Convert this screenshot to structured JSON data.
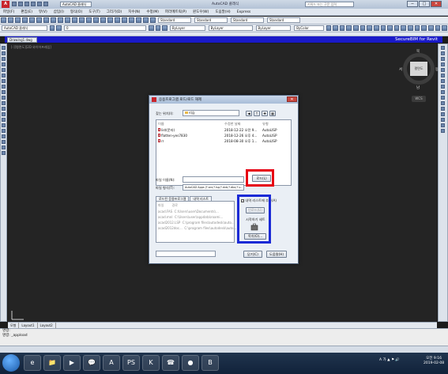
{
  "app": {
    "title": "AutoCAD 클래식",
    "workspace": "AutoCAD 클래식",
    "search_placeholder": "키워드 또는 구문 입력",
    "window_buttons": [
      "─",
      "□",
      "✕"
    ]
  },
  "menu": [
    "파일(F)",
    "편집(E)",
    "뷰(V)",
    "삽입(I)",
    "형식(O)",
    "도구(T)",
    "그리기(D)",
    "치수(N)",
    "수정(M)",
    "파라메트릭(P)",
    "윈도우(W)",
    "도움말(H)",
    "Express"
  ],
  "toolbars": {
    "style_combos": [
      "Standard",
      "Standard",
      "Standard",
      "Standard"
    ],
    "workspace_combo": "AutoCAD 클래식",
    "layer_combo": "0",
    "bylayer_1": "ByLayer",
    "bylayer_2": "ByLayer",
    "bylayer_3": "ByLayer",
    "bycolor": "ByColor"
  },
  "drawing_tab": {
    "file": "Drawing1.dwg",
    "brand": "SecureBIM for Revit"
  },
  "viewport": {
    "label": "[-][평면도][2D 와이어프레임]",
    "viewcube_face": "평면도",
    "compass": {
      "n": "북",
      "s": "남",
      "w": "서",
      "e": "동"
    },
    "wcs": "WCS"
  },
  "model_tabs": [
    "모형",
    "Layout1",
    "Layout2"
  ],
  "command": {
    "line1": "명령:",
    "line2": "명령: _appload"
  },
  "dialog": {
    "title": "응용프로그램 로드/로드 해제",
    "look_in_label": "찾는 위치(I):",
    "look_in_value": "리습",
    "columns": [
      "이름",
      "수정한 날짜",
      "유형"
    ],
    "files": [
      {
        "name": "list(문자)",
        "date": "2018-12-22 오전 9...",
        "type": "AutoLISP"
      },
      {
        "name": "flatten-yes7830",
        "date": "2018-12-26 오후 4...",
        "type": "AutoLISP"
      },
      {
        "name": "rr",
        "date": "2018-08-30 오후 1...",
        "type": "AutoLISP"
      }
    ],
    "filename_label": "파일 이름(N):",
    "filename_value": "",
    "filetype_label": "파일 형식(T):",
    "filetype_value": "AutoCAD Apps (*.arx;*.lsp;*.dvb;*.dbx;*.v...",
    "load_button": "로드(L)",
    "loaded_tabs": [
      "로드된 응용프로그램",
      "내역 리스트"
    ],
    "loaded_columns": [
      "파일",
      "경로"
    ],
    "loaded_rows": [
      {
        "file": "acad.FAS",
        "path": "C:\\Users\\user\\Documents\\..."
      },
      {
        "file": "acad.mnl",
        "path": "C:\\Users\\user\\appdata\\roami..."
      },
      {
        "file": "acad2012.LSP",
        "path": "C:\\program files\\autodesk\\auto..."
      },
      {
        "file": "acad2012doc...",
        "path": "C:\\program files\\autodesk\\auto..."
      }
    ],
    "add_history_checkbox": "내역 리스트에 추가(A)",
    "unload_button": "언로드(U)",
    "startup_suite_label": "시작하기 세트",
    "contents_button": "목차(O)...",
    "close_button": "닫기(C)",
    "help_button": "도움말(H)",
    "status_text": ""
  },
  "taskbar": {
    "apps": [
      "e",
      "📁",
      "▶",
      "💬",
      "A",
      "PS",
      "K",
      "☎",
      "●",
      "B"
    ],
    "tray": "A 가 ▲ ⚑ 🔊",
    "time": "오전 9:16",
    "date": "2019-02-08"
  }
}
